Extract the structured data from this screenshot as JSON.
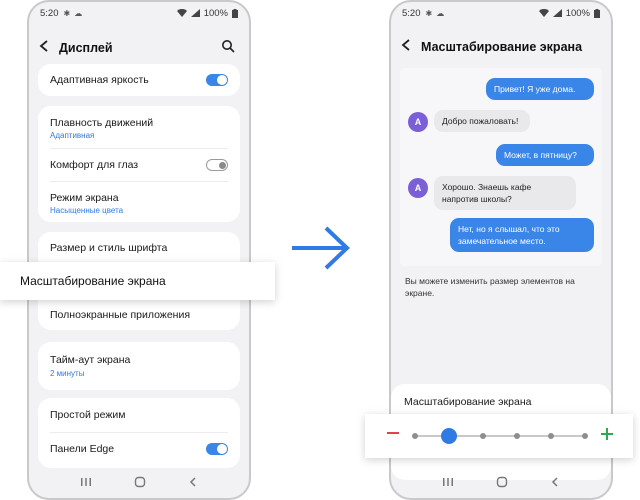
{
  "status_bar": {
    "time": "5:20",
    "battery": "100%"
  },
  "left_screen": {
    "title": "Дисплей",
    "settings": {
      "adaptive_brightness": {
        "label": "Адаптивная яркость",
        "on": true
      },
      "motion_smoothness": {
        "label": "Плавность движений",
        "value": "Адаптивная"
      },
      "eye_comfort": {
        "label": "Комфорт для глаз",
        "on": false
      },
      "screen_mode": {
        "label": "Режим экрана",
        "value": "Насыщенные цвета"
      },
      "font_size_style": {
        "label": "Размер и стиль шрифта"
      },
      "screen_zoom": {
        "label": "Масштабирование экрана"
      },
      "fullscreen_apps": {
        "label": "Полноэкранные приложения"
      },
      "screen_timeout": {
        "label": "Тайм-аут экрана",
        "value": "2 минуты"
      },
      "easy_mode": {
        "label": "Простой режим"
      },
      "edge_panels": {
        "label": "Панели Edge",
        "on": true
      }
    }
  },
  "right_screen": {
    "title": "Масштабирование экрана",
    "avatar_letter": "A",
    "messages": [
      {
        "dir": "out",
        "text": "Привет! Я уже дома."
      },
      {
        "dir": "in",
        "text": "Добро пожаловать!"
      },
      {
        "dir": "out",
        "text": "Может, в пятницу?"
      },
      {
        "dir": "in",
        "text": "Хорошо. Знаешь кафе напротив школы?"
      },
      {
        "dir": "out",
        "text": "Нет, но я слышал, что это замечательное место."
      }
    ],
    "description": "Вы можете изменить размер элементов на экране.",
    "zoom_label": "Масштабирование экрана",
    "zoom_level": {
      "value": 2,
      "min": 1,
      "max": 6
    }
  },
  "colors": {
    "accent": "#3a86e8",
    "minus": "#e04545",
    "plus": "#2faa4a"
  },
  "icons": {
    "back": "arrow-left-icon",
    "search": "search-icon",
    "arrow": "arrow-right-icon",
    "minus": "minus-icon",
    "plus": "plus-icon",
    "recent": "recent-apps-icon",
    "home": "home-icon",
    "nav_back": "nav-back-icon"
  }
}
